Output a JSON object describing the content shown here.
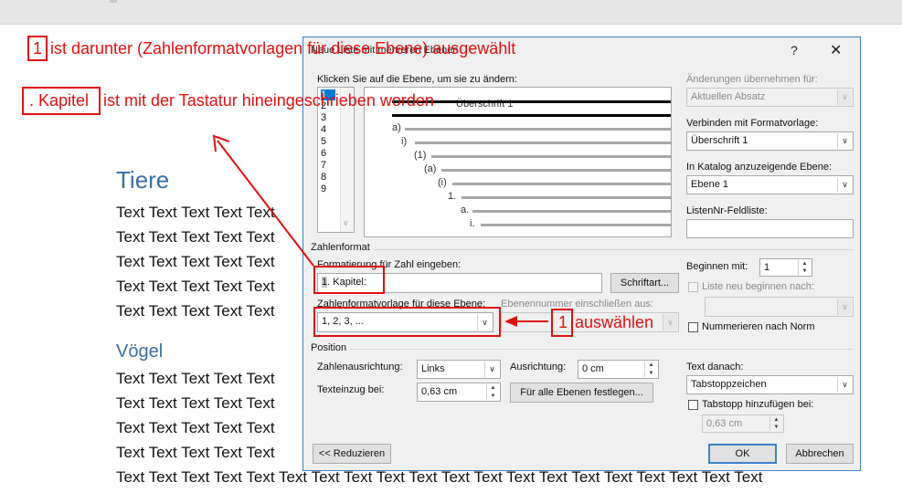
{
  "document": {
    "heading1": "Tiere",
    "heading2": "Vögel",
    "line_text": "Text Text Text Text Text",
    "last_line_text": "Text Text Text Text Text Text Text Text Text Text Text Text Text Text Text Text Text Text Text Text"
  },
  "annotations": {
    "top_note_number": "1",
    "top_note_text": "ist darunter (Zahlenformatvorlagen für diese Ebene) ausgewählt",
    "second_note_word": ". Kapitel",
    "second_note_text": "ist mit der Tastatur hineingeschrieben worden",
    "select_note_number": "1",
    "select_note_text": "auswählen"
  },
  "dialog": {
    "title": "Neue Liste mit mehreren Ebenen",
    "help_icon": "?",
    "close_icon": "✕",
    "click_level_label": "Klicken Sie auf die Ebene, um sie zu ändern:",
    "levels": [
      "1",
      "2",
      "3",
      "4",
      "5",
      "6",
      "7",
      "8",
      "9"
    ],
    "preview": {
      "top_label": "Überschrift 1",
      "labels": [
        "a)",
        "i)",
        "(1)",
        "(a)",
        "(i)",
        "1.",
        "a.",
        "i."
      ]
    },
    "apply_to_label": "Änderungen übernehmen für:",
    "apply_to_value": "Aktuellen Absatz",
    "link_style_label": "Verbinden mit Formatvorlage:",
    "link_style_value": "Überschrift 1",
    "gallery_level_label": "In Katalog anzuzeigende Ebene:",
    "gallery_level_value": "Ebene 1",
    "listnum_label": "ListenNr-Feldliste:",
    "listnum_value": "",
    "number_format_group": "Zahlenformat",
    "enter_format_label": "Formatierung für Zahl eingeben:",
    "format_value_highlight": "1",
    "format_value_rest": ". Kapitel:",
    "font_button": "Schriftart...",
    "number_style_label": "Zahlenformatvorlage für diese Ebene:",
    "number_style_value": "1, 2, 3, ...",
    "include_level_label": "Ebenennummer einschließen aus:",
    "include_level_value": "",
    "start_at_label": "Beginnen mit:",
    "start_at_value": "1",
    "restart_label": "Liste neu beginnen nach:",
    "restart_value": "",
    "legal_label": "Nummerieren nach Norm",
    "position_group": "Position",
    "alignment_label": "Zahlenausrichtung:",
    "alignment_value": "Links",
    "aligned_at_label": "Ausrichtung:",
    "aligned_at_value": "0 cm",
    "indent_label": "Texteinzug bei:",
    "indent_value": "0,63 cm",
    "set_all_button": "Für alle Ebenen festlegen...",
    "follow_label": "Text danach:",
    "follow_value": "Tabstoppzeichen",
    "add_tab_label": "Tabstopp hinzufügen bei:",
    "add_tab_value": "0,63 cm",
    "less_button": "<< Reduzieren",
    "ok_button": "OK",
    "cancel_button": "Abbrechen"
  },
  "colors": {
    "annotation": "#e01010",
    "heading": "#3c6fa3",
    "dialog_border": "#3c82c8",
    "selection": "#0078d7"
  }
}
